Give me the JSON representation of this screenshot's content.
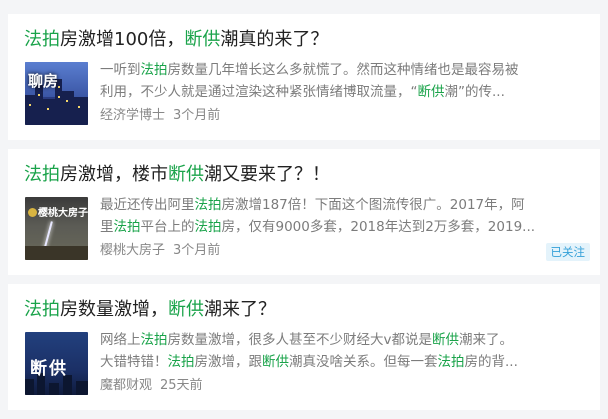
{
  "articles": [
    {
      "title_parts": [
        "法拍",
        "房激增100倍，",
        "断供",
        "潮真的来了？"
      ],
      "snippet_line1": [
        "一听到",
        "法拍",
        "房数量几年增长这么多就慌了。然而这种情绪也是最容易被"
      ],
      "snippet_line2": [
        "利用，不少人就是通过渲染这种紧张情绪博取流量，“",
        "断供",
        "潮”的传..."
      ],
      "source": "经济学博士",
      "time": "3个月前",
      "thumb_text": "聊房"
    },
    {
      "title_parts": [
        "法拍",
        "房激增，楼市",
        "断供",
        "潮又要来了？！"
      ],
      "snippet_line1": [
        "最近还传出阿里",
        "法拍",
        "房激增187倍！下面这个图流传很广。2017年，阿"
      ],
      "snippet_line2": [
        "里",
        "法拍",
        "平台上的",
        "法拍",
        "房，仅有9000多套，2018年达到2万多套，2019..."
      ],
      "source": "樱桃大房子",
      "time": "3个月前",
      "badge": "已关注",
      "thumb_text": "樱桃大房子"
    },
    {
      "title_parts": [
        "法拍",
        "房数量激增，",
        "断供",
        "潮来了？"
      ],
      "snippet_line1": [
        "网络上",
        "法拍",
        "房数量激增，很多人甚至不少财经大v都说是",
        "断供",
        "潮来了。"
      ],
      "snippet_line2": [
        "大错特错！",
        "法拍",
        "房激增，跟",
        "断供",
        "潮真没啥关系。但每一套",
        "法拍",
        "房的背..."
      ],
      "source": "魔都财观",
      "time": "25天前",
      "thumb_text": "断供"
    }
  ],
  "colors": {
    "highlight": "#1aa34a",
    "badge_text": "#35a0d8",
    "badge_bg": "#e4f3fb"
  }
}
